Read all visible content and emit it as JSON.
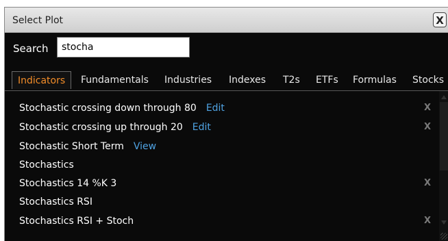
{
  "dialog": {
    "title": "Select Plot",
    "close_label": "X"
  },
  "search": {
    "label": "Search",
    "value": "stocha"
  },
  "tabs": [
    {
      "label": "Indicators",
      "active": true
    },
    {
      "label": "Fundamentals"
    },
    {
      "label": "Industries"
    },
    {
      "label": "Indexes"
    },
    {
      "label": "T2s"
    },
    {
      "label": "ETFs"
    },
    {
      "label": "Formulas"
    },
    {
      "label": "Stocks"
    }
  ],
  "results": [
    {
      "name": "Stochastic crossing down through 80",
      "link": "Edit",
      "remove": "X"
    },
    {
      "name": "Stochastic crossing up through 20",
      "link": "Edit",
      "remove": "X"
    },
    {
      "name": "Stochastic Short Term",
      "link": "View"
    },
    {
      "name": "Stochastics"
    },
    {
      "name": "Stochastics 14 %K 3",
      "remove": "X"
    },
    {
      "name": "Stochastics RSI"
    },
    {
      "name": "Stochastics RSI + Stoch",
      "remove": "X"
    }
  ],
  "colors": {
    "active_tab": "#f28c28",
    "link": "#4fa3e3",
    "background": "#0a0a0a"
  }
}
